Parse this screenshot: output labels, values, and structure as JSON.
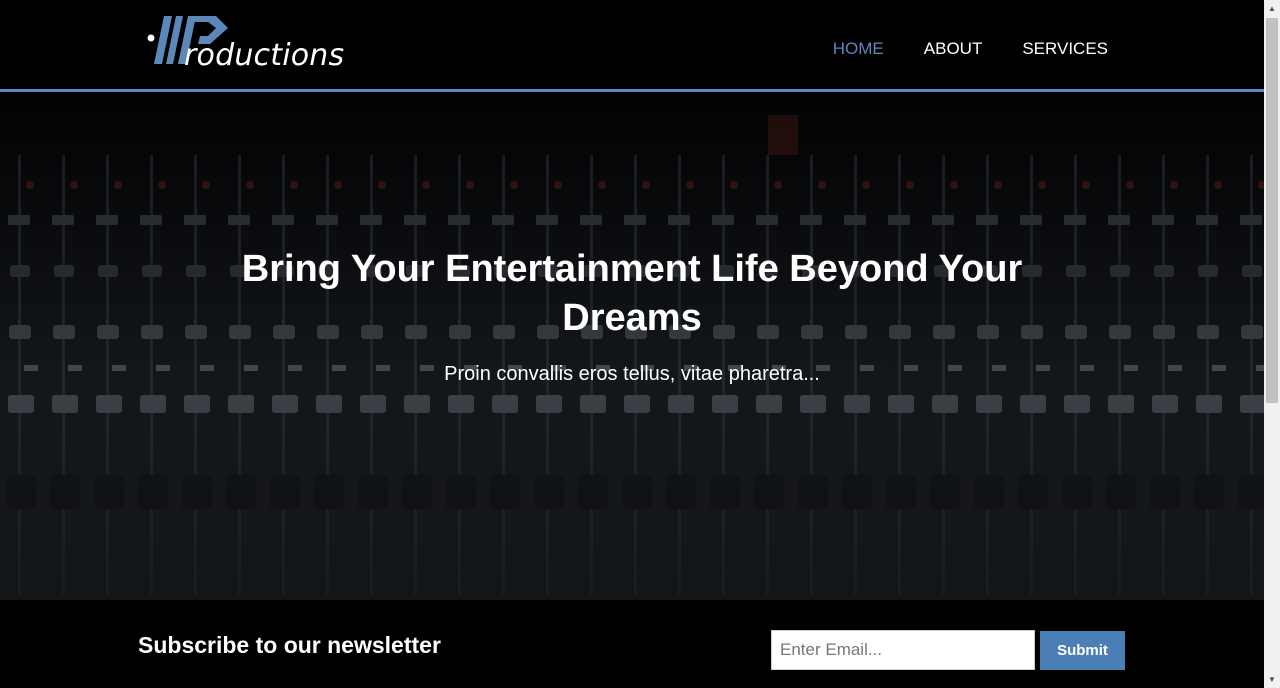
{
  "header": {
    "logo_text": "roductions",
    "nav": [
      {
        "label": "HOME",
        "active": true
      },
      {
        "label": "ABOUT",
        "active": false
      },
      {
        "label": "SERVICES",
        "active": false
      }
    ]
  },
  "hero": {
    "title": "Bring Your Entertainment Life Beyond Your Dreams",
    "subtitle": "Proin convallis eros tellus, vitae pharetra..."
  },
  "newsletter": {
    "title": "Subscribe to our newsletter",
    "email_placeholder": "Enter Email...",
    "submit_label": "Submit"
  },
  "colors": {
    "accent": "#5b87b9",
    "button": "#4a7eb5",
    "background": "#000000"
  }
}
